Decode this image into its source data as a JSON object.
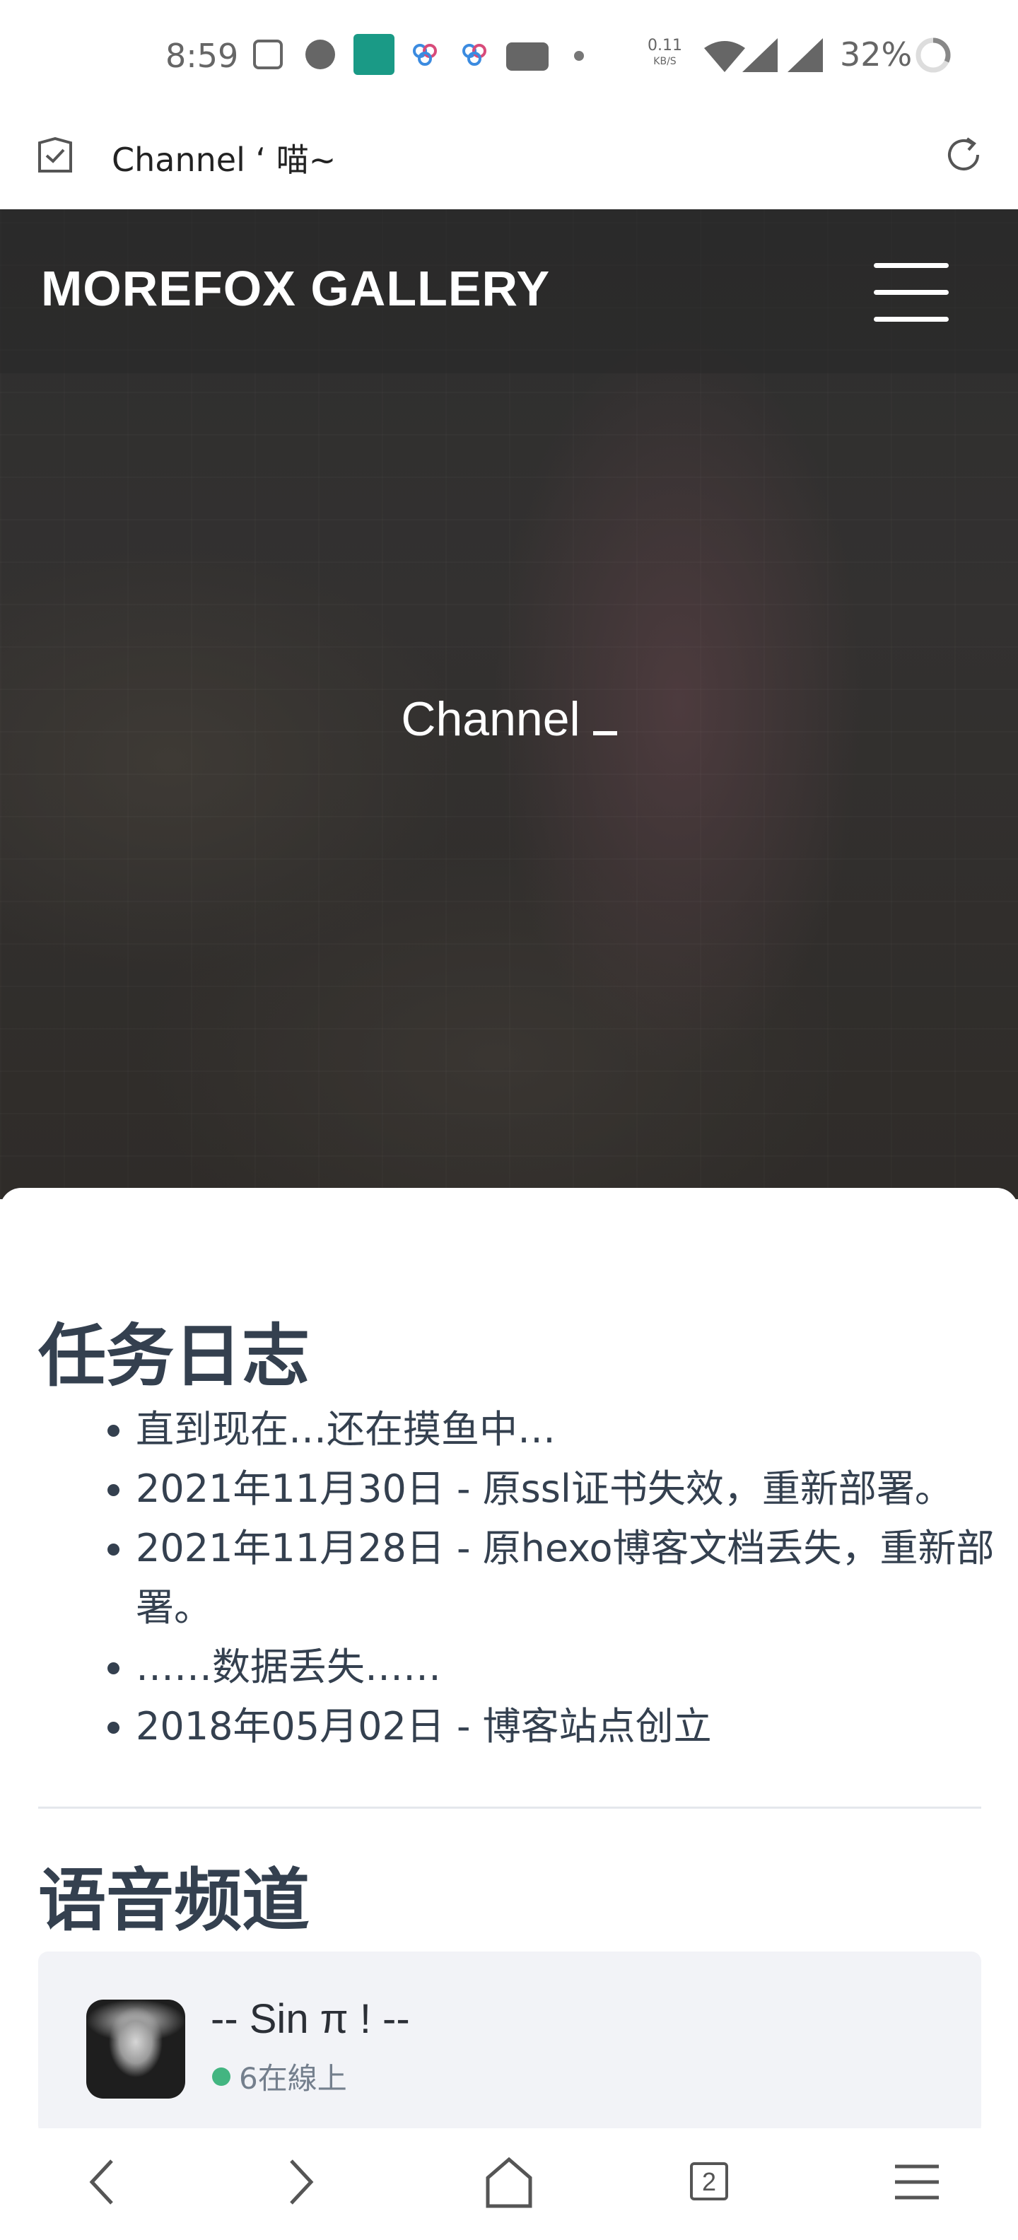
{
  "status_bar": {
    "time": "8:59",
    "net_speed_value": "0.11",
    "net_speed_unit": "KB/S",
    "battery": "32%",
    "icons": [
      "gmail-icon",
      "message-icon",
      "android-icon",
      "app-icon",
      "app-icon",
      "youtube-icon",
      "dot-icon",
      "wifi-icon",
      "signal-icon",
      "signal-icon",
      "battery-ring-icon"
    ]
  },
  "address_bar": {
    "title": "Channel ‘ 喵~",
    "icons": [
      "shield-icon",
      "reload-icon"
    ]
  },
  "site": {
    "brand": "MOREFOX GALLERY",
    "hero_title": "Channel"
  },
  "log_section": {
    "title": "任务日志",
    "items": [
      "直到现在…还在摸鱼中…",
      "2021年11月30日 - 原ssl证书失效，重新部署。",
      "2021年11月28日 - 原hexo博客文档丢失，重新部署。",
      "……数据丢失……",
      "2018年05月02日 - 博客站点创立"
    ]
  },
  "voice_section": {
    "title": "语音频道",
    "server_name": "-- Sin π ! --",
    "online": "6在線上",
    "online_color": "#43b581"
  },
  "bottom_nav": {
    "tab_count": "2",
    "icons": [
      "back-icon",
      "forward-icon",
      "home-icon",
      "tabs-icon",
      "menu-icon"
    ]
  }
}
